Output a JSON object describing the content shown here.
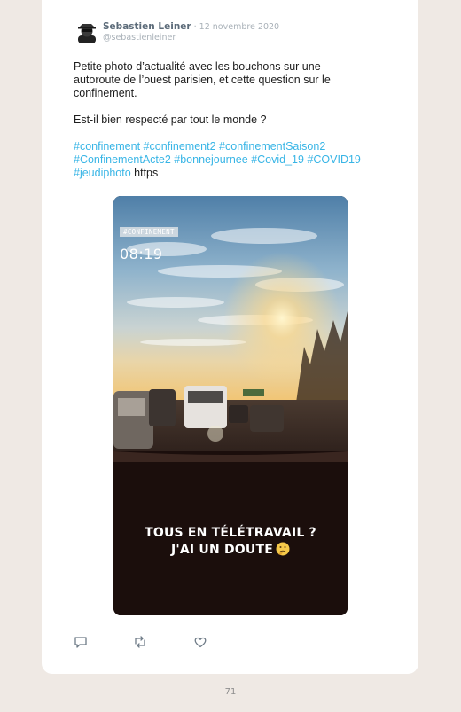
{
  "tweet": {
    "author_name": "Sebastien Leiner",
    "date_separator": " · ",
    "date": "12 novembre 2020",
    "handle": "@sebastienleiner",
    "paragraph1": "Petite photo d’actualité avec les bouchons sur une autoroute de l’ouest parisien, et cette question sur le confinement.",
    "paragraph2": "Est-il bien respecté par tout le monde ?",
    "hashtags": [
      "#confinement",
      "#confinement2",
      "#confinementSaison2",
      "#ConfinementActe2",
      "#bonnejournee",
      "#Covid_19",
      "#COVID19",
      "#jeudiphoto"
    ],
    "link_text": "https"
  },
  "photo": {
    "tag_text": "#CONFINEMENT",
    "time_text": "08:19",
    "caption_line1": "TOUS EN TÉLÉTRAVAIL ?",
    "caption_line2": "J'AI UN DOUTE"
  },
  "actions": {
    "icons": [
      "reply-icon",
      "retweet-icon",
      "like-icon"
    ]
  },
  "page": {
    "number": "71"
  },
  "colors": {
    "background": "#efe9e4",
    "card": "#ffffff",
    "hashtag": "#38b5e6",
    "author_name": "#5c6b79",
    "muted": "#a9b1b8"
  }
}
